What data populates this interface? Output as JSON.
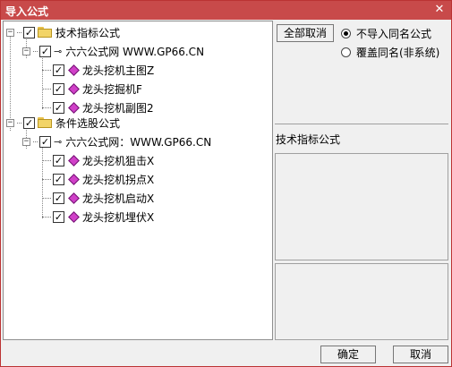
{
  "window": {
    "title": "导入公式",
    "close_glyph": "✕"
  },
  "tree": {
    "groups": [
      {
        "label": "技术指标公式",
        "source": "六六公式网 WWW.GP66.CN",
        "items": [
          "龙头挖机主图Z",
          "龙头挖掘机F",
          "龙头挖机副图2"
        ]
      },
      {
        "label": "条件选股公式",
        "source": "六六公式网：WWW.GP66.CN",
        "items": [
          "龙头挖机狙击X",
          "龙头挖机拐点X",
          "龙头挖机启动X",
          "龙头挖机埋伏X"
        ]
      }
    ]
  },
  "options": {
    "select_all_button": "全部取消",
    "radio_skip": "不导入同名公式",
    "radio_overwrite": "覆盖同名(非系统)",
    "selected": "skip"
  },
  "detail": {
    "title": "技术指标公式"
  },
  "footer": {
    "ok_label": "确定",
    "cancel_label": "取消"
  },
  "icons": {
    "check": "✓",
    "collapse": "−",
    "key": "⊸"
  },
  "colors": {
    "titlebar": "#c84a4a",
    "gem": "#d040c8",
    "folder": "#f2d467"
  }
}
